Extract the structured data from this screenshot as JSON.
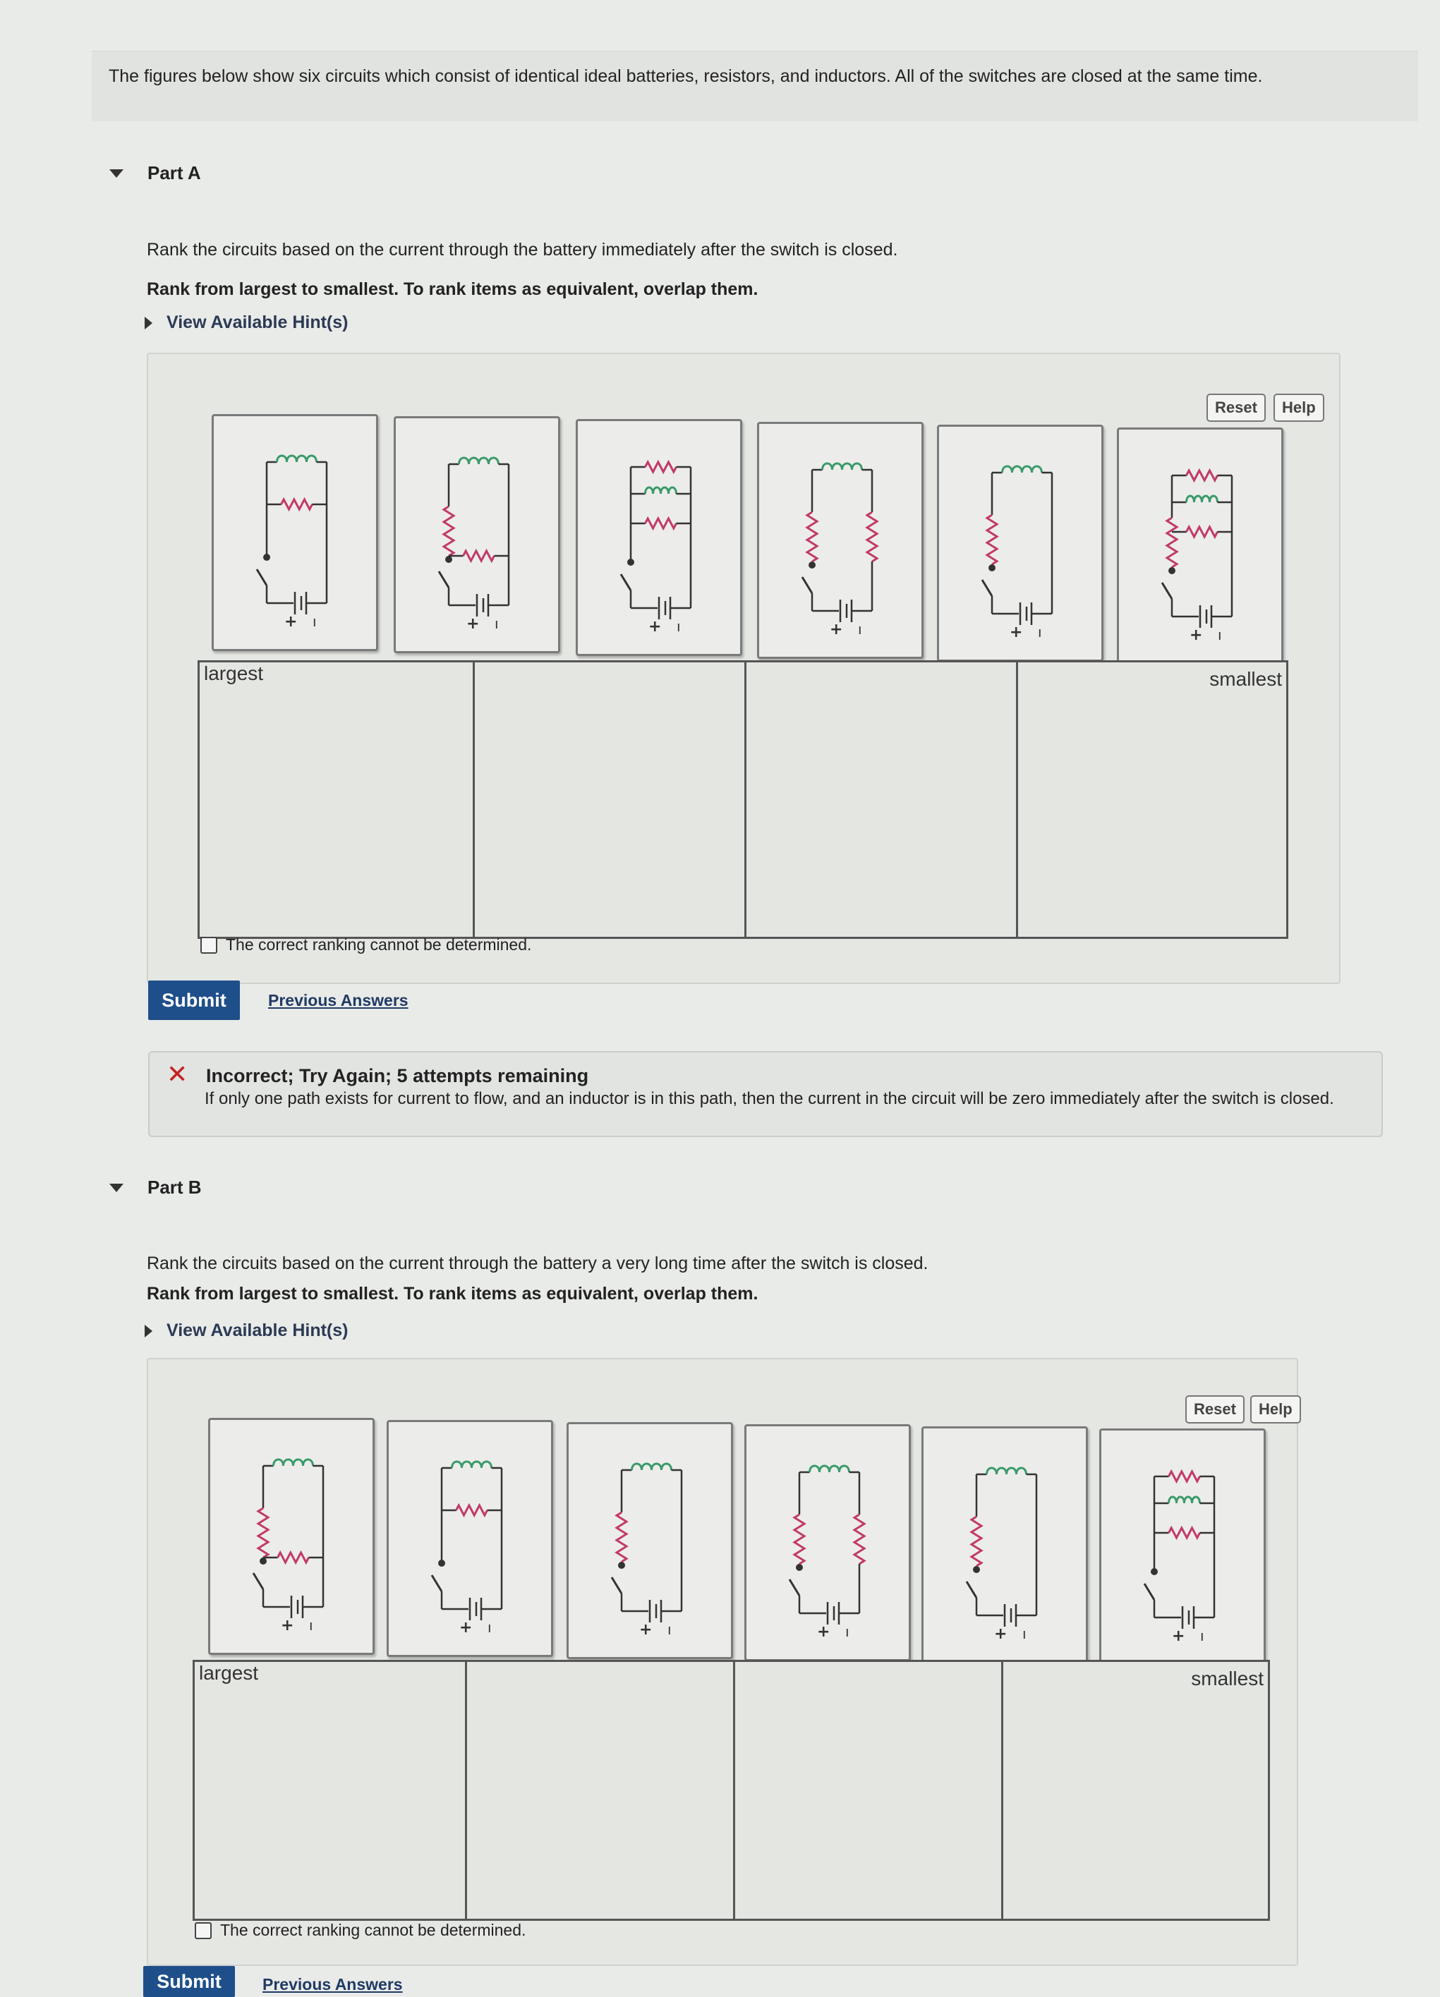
{
  "intro": "The figures below show six circuits which consist of identical ideal batteries, resistors, and inductors. All of the switches are closed at the same time.",
  "part_a": {
    "title": "Part A",
    "question": "Rank the circuits based on the current through the battery immediately after the switch is closed.",
    "instruction": "Rank from largest to smallest. To rank items as equivalent, overlap them.",
    "hint": "View Available Hint(s)",
    "reset": "Reset",
    "help": "Help",
    "largest": "largest",
    "smallest": "smallest",
    "cannot": "The correct ranking cannot be determined.",
    "submit": "Submit",
    "previous": "Previous Answers",
    "feedback_title": "Incorrect; Try Again; 5 attempts remaining",
    "feedback_msg": "If only one path exists for current to flow, and an inductor is in this path, then the current in the circuit will be zero immediately after the switch is closed."
  },
  "part_b": {
    "title": "Part B",
    "question": "Rank the circuits based on the current through the battery a very long time after the switch is closed.",
    "instruction": "Rank from largest to smallest. To rank items as equivalent, overlap them.",
    "hint": "View Available Hint(s)",
    "reset": "Reset",
    "help": "Help",
    "largest": "largest",
    "smallest": "smallest",
    "cannot": "The correct ranking cannot be determined.",
    "submit": "Submit",
    "previous": "Previous Answers"
  },
  "circuit": {
    "plus": "+",
    "minus": "ı"
  },
  "colors": {
    "inductor": "#3a9a6a",
    "resistor": "#c23a6a",
    "wire": "#333333",
    "submit": "#1f4f8a",
    "error": "#c62020"
  }
}
